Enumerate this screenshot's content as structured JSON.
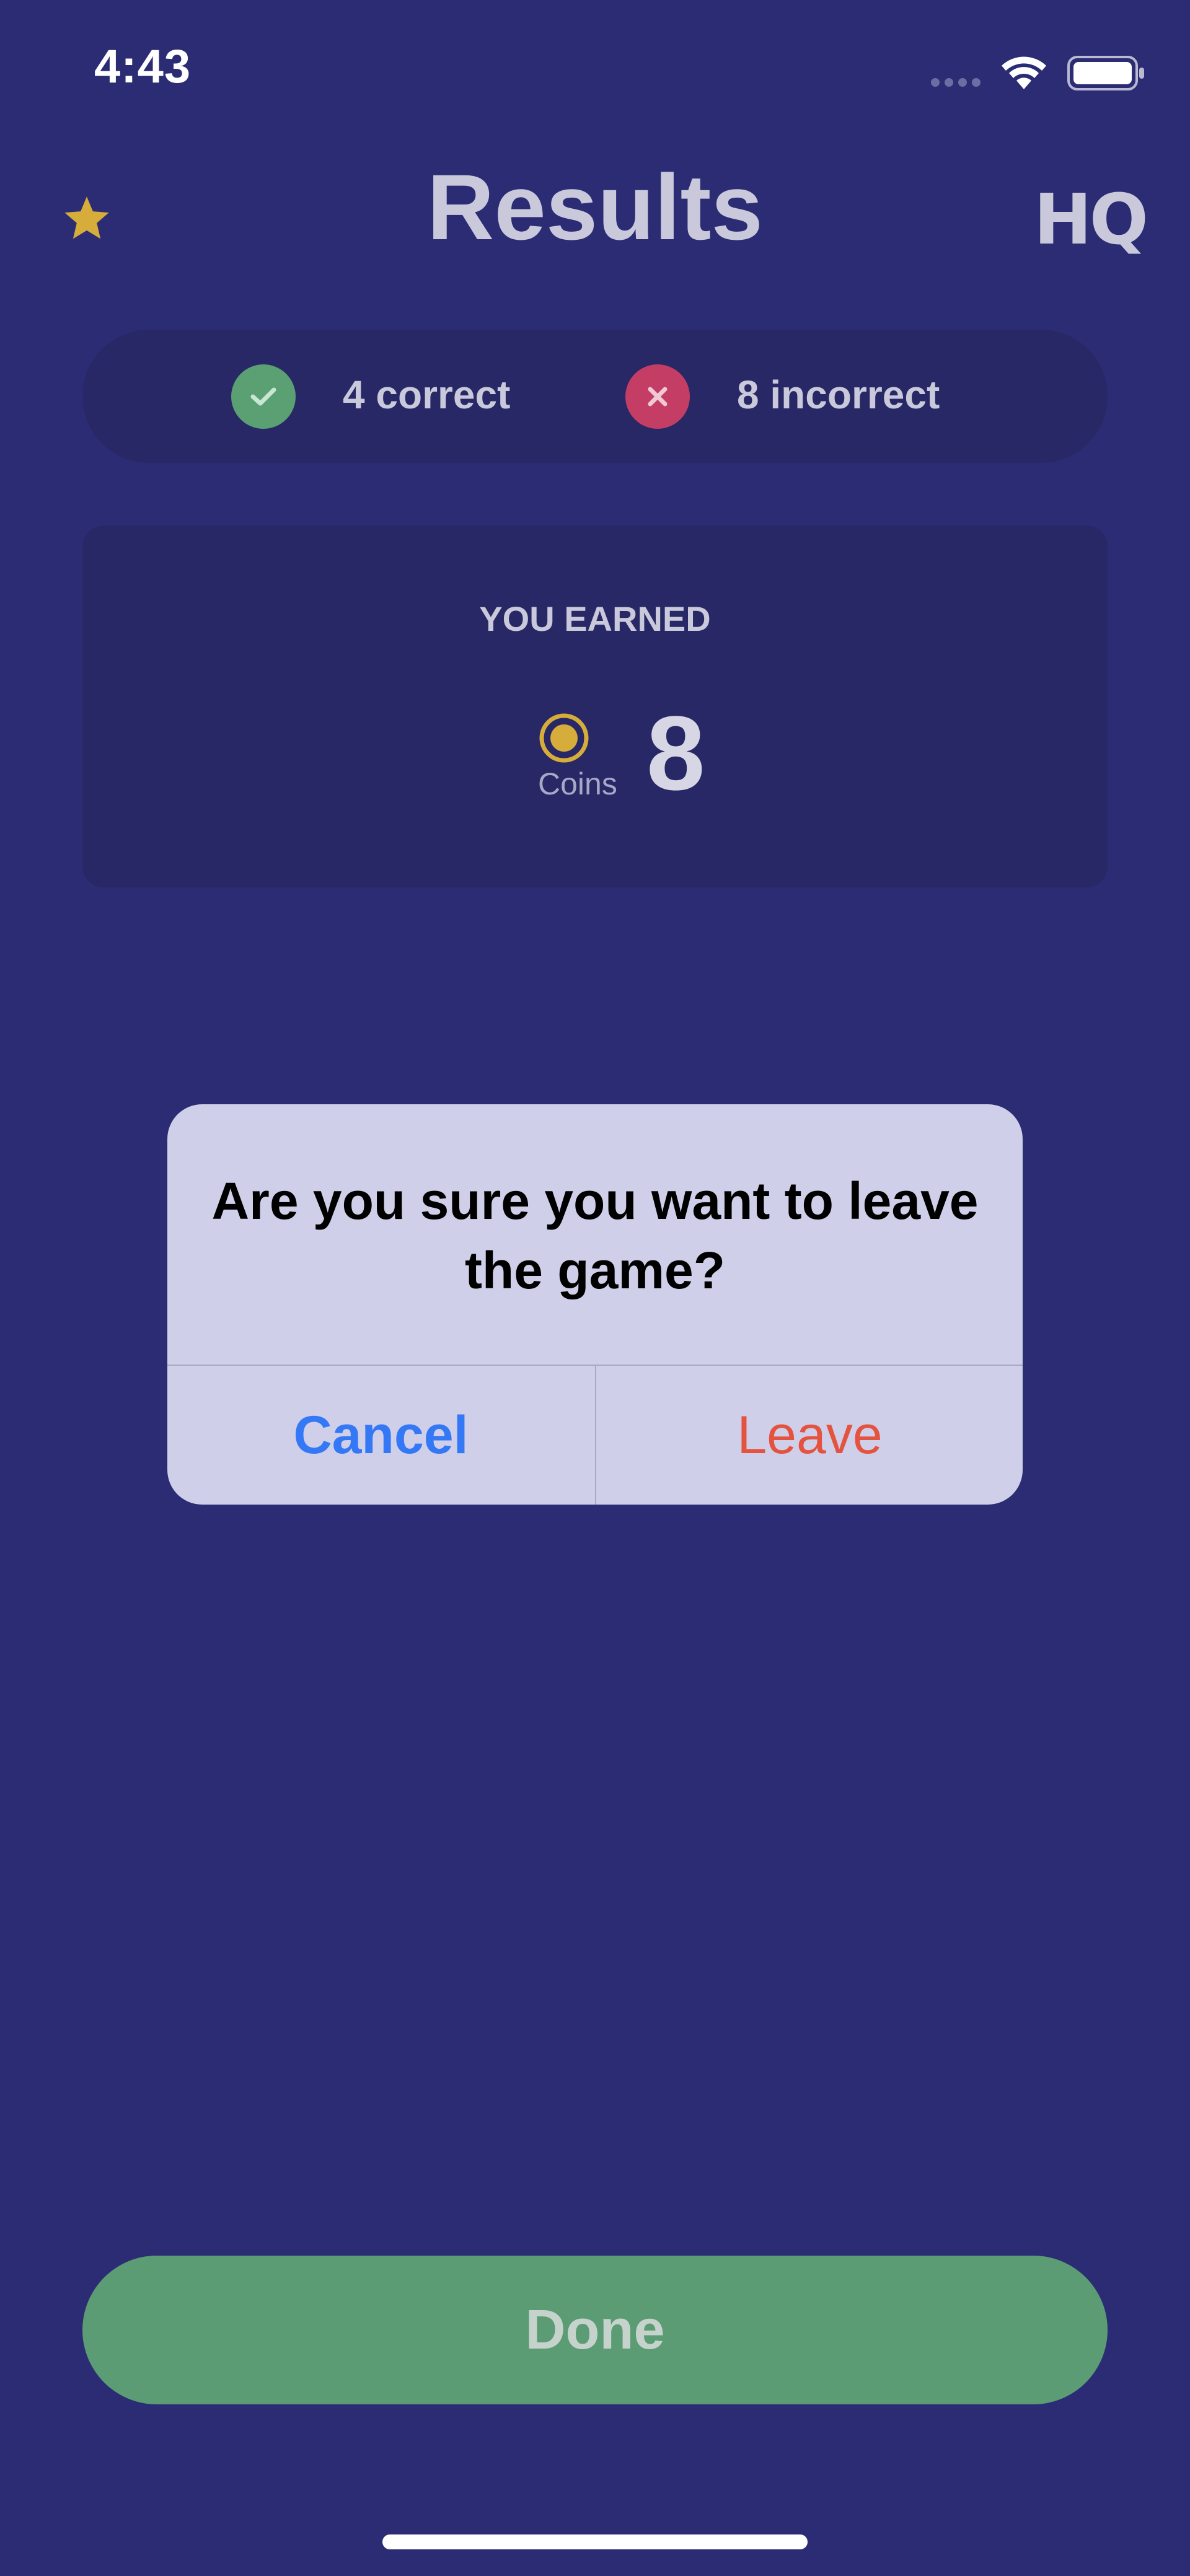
{
  "status_bar": {
    "time": "4:43",
    "icons": [
      "signal-dots-icon",
      "wifi-icon",
      "battery-icon"
    ]
  },
  "header": {
    "title": "Results",
    "logo": "HQ",
    "left_icon": "star-icon"
  },
  "score": {
    "correct_text": "4 correct",
    "incorrect_text": "8 incorrect",
    "correct_icon": "checkmark-icon",
    "incorrect_icon": "x-icon"
  },
  "earned": {
    "label": "YOU EARNED",
    "coins_label": "Coins",
    "coins_value": "8",
    "icon": "coin-icon"
  },
  "alert": {
    "message": "Are you sure you want to leave the game?",
    "cancel_label": "Cancel",
    "leave_label": "Leave"
  },
  "footer": {
    "done_label": "Done"
  },
  "colors": {
    "background": "#2b2c74",
    "panel": "#272865",
    "correct": "#5aa072",
    "incorrect": "#c33d64",
    "coin": "#d6ac3a",
    "done_button": "#5b9c74",
    "alert_background": "#cfcfe9",
    "cancel_text": "#3478f6",
    "leave_text": "#e4533f"
  }
}
